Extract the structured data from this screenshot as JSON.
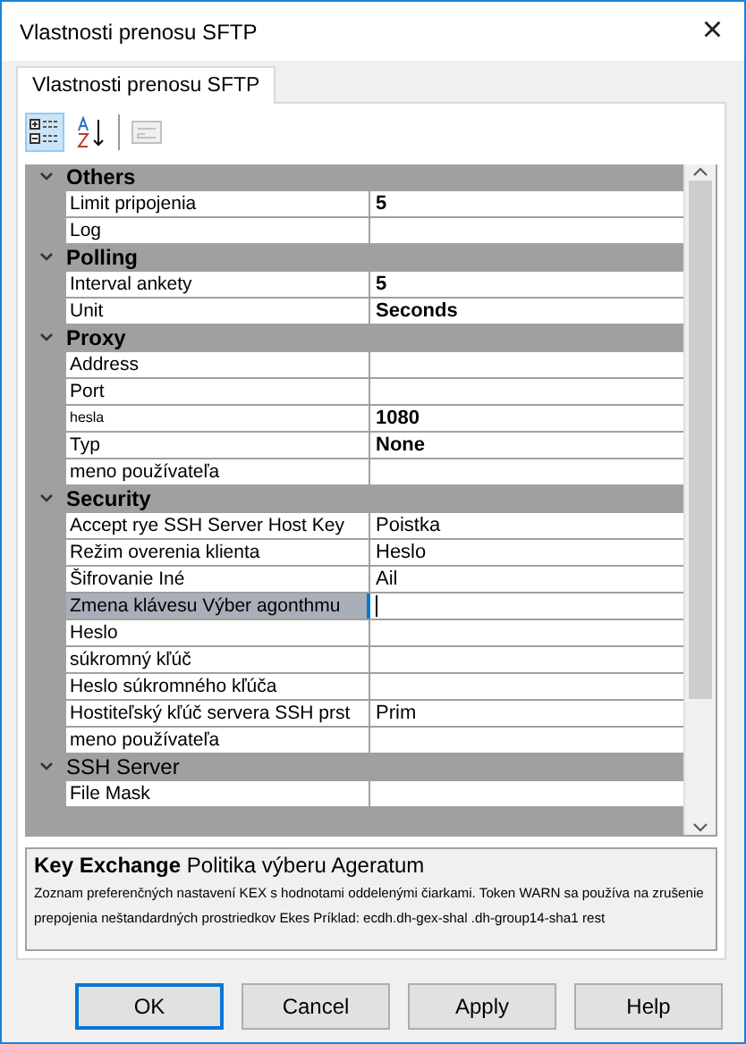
{
  "window": {
    "title": "Vlastnosti prenosu SFTP",
    "close": "×"
  },
  "tabs": [
    {
      "label": "Vlastnosti prenosu SFTP",
      "selected": true
    }
  ],
  "toolbar": [
    {
      "kind": "categorized",
      "selected": true,
      "disabled": false
    },
    {
      "kind": "alphabetical",
      "selected": false,
      "disabled": false
    },
    {
      "kind": "separator"
    },
    {
      "kind": "pages",
      "selected": false,
      "disabled": true
    }
  ],
  "grid": {
    "categories": [
      {
        "name": "Others",
        "bold": true,
        "expanded": true,
        "items": [
          {
            "name": "Limit pripojenia",
            "value": "5",
            "modified": true,
            "selected": false
          },
          {
            "name": "Log",
            "value": "",
            "modified": false,
            "selected": false
          }
        ]
      },
      {
        "name": "Polling",
        "bold": true,
        "expanded": true,
        "items": [
          {
            "name": "Interval ankety",
            "value": "5",
            "modified": true,
            "selected": false
          },
          {
            "name": "Unit",
            "value": "Seconds",
            "modified": true,
            "selected": false
          }
        ]
      },
      {
        "name": "Proxy",
        "bold": true,
        "expanded": true,
        "items": [
          {
            "name": "Address",
            "value": "",
            "modified": false,
            "selected": false
          },
          {
            "name": "Port",
            "value": "",
            "modified": false,
            "selected": false
          },
          {
            "name": "hesla",
            "value": "1080",
            "modified": true,
            "selected": false,
            "small": true
          },
          {
            "name": "Typ",
            "value": "None",
            "modified": true,
            "selected": false
          },
          {
            "name": "meno používateľa",
            "value": "",
            "modified": false,
            "selected": false
          }
        ]
      },
      {
        "name": "Security",
        "bold": true,
        "expanded": true,
        "items": [
          {
            "name": "Accept rye SSH Server Host Key",
            "value": "Poistka",
            "modified": false,
            "selected": false
          },
          {
            "name": "Režim overenia klienta",
            "value": "Heslo",
            "modified": false,
            "selected": false
          },
          {
            "name": "Šifrovanie Iné",
            "value": "Ail",
            "modified": false,
            "selected": false
          },
          {
            "name": "Zmena klávesu Výber agonthmu",
            "value": "",
            "modified": false,
            "selected": true
          },
          {
            "name": "Heslo",
            "value": "",
            "modified": false,
            "selected": false
          },
          {
            "name": "súkromný kľúč",
            "value": "",
            "modified": false,
            "selected": false
          },
          {
            "name": "Heslo súkromného kľúča",
            "value": "",
            "modified": false,
            "selected": false
          },
          {
            "name": "Hostiteľský kľúč servera SSH prst",
            "value": "Prim",
            "modified": false,
            "selected": false
          },
          {
            "name": "meno používateľa",
            "value": "",
            "modified": false,
            "selected": false
          }
        ]
      },
      {
        "name": "SSH Server",
        "bold": false,
        "expanded": true,
        "items": [
          {
            "name": "File Mask",
            "value": "",
            "modified": false,
            "selected": false
          }
        ]
      }
    ]
  },
  "description": {
    "title": "Key Exchange",
    "subtitle": "Politika výberu Ageratum",
    "text": "Zoznam preferenčných nastavení KEX s hodnotami oddelenými čiarkami. Token WARN sa používa na zrušenie prepojenia neštandardných prostriedkov Ekes Príklad: ecdh.dh-gex-shal .dh-group14-sha1 rest"
  },
  "buttons": [
    {
      "label": "OK",
      "default": true
    },
    {
      "label": "Cancel",
      "default": false
    },
    {
      "label": "Apply",
      "default": false
    },
    {
      "label": "Help",
      "default": false
    }
  ]
}
